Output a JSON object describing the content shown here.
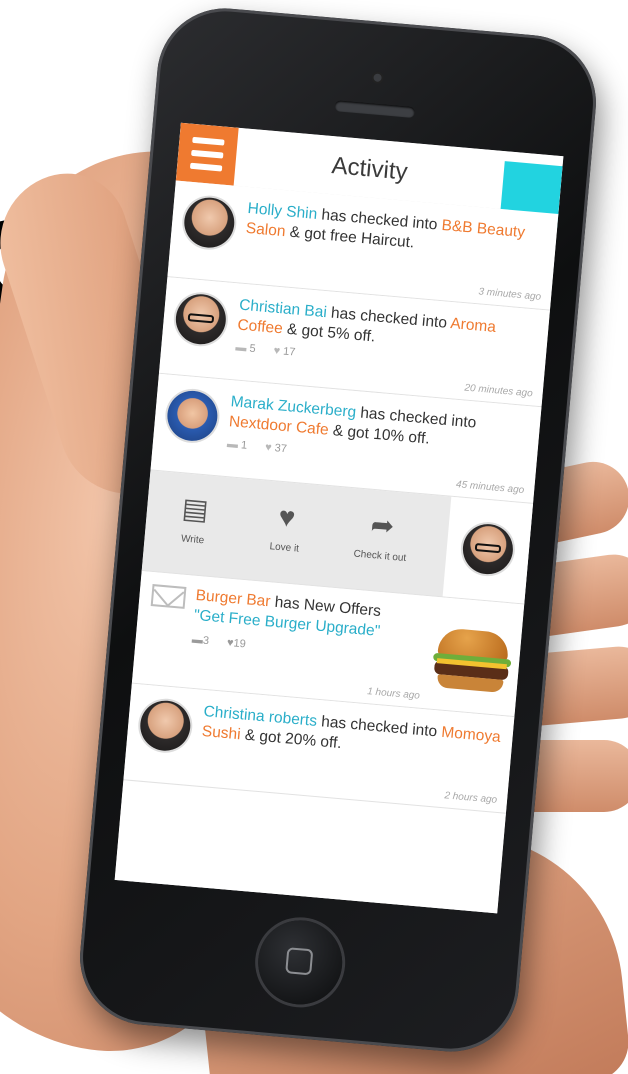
{
  "header": {
    "title": "Activity"
  },
  "feed": [
    {
      "name": "Holly Shin",
      "action": "has checked into",
      "place": "B&B Beauty Salon",
      "reward": "& got free Haircut.",
      "time": "3 minutes ago"
    },
    {
      "name": "Christian Bai",
      "action": "has checked into",
      "place": "Aroma Coffee",
      "reward": "& got 5% off.",
      "comments": "5",
      "likes": "17",
      "time": "20 minutes ago"
    },
    {
      "name": "Marak Zuckerberg",
      "action": "has checked into",
      "place": "Nextdoor Cafe",
      "reward": "& got 10% off.",
      "comments": "1",
      "likes": "37",
      "time": "45 minutes ago"
    }
  ],
  "actions": {
    "write": "Write",
    "love": "Love it",
    "check": "Check it out"
  },
  "offer": {
    "place": "Burger Bar",
    "text": "has New Offers",
    "offer_title": "\"Get Free Burger Upgrade\"",
    "comments": "3",
    "likes": "19",
    "time": "1 hours ago"
  },
  "last_item": {
    "name": "Christina roberts",
    "action": "has checked into",
    "place": "Momoya Sushi",
    "reward": "& got 20% off.",
    "time": "2 hours ago"
  },
  "icons": {
    "menu": "menu-icon",
    "comment": "comment-icon",
    "heart": "heart-icon",
    "share": "share-icon",
    "envelope": "envelope-icon"
  },
  "colors": {
    "accent_orange": "#ef7a30",
    "accent_cyan": "#22d3e0",
    "name_blue": "#2aaec9"
  }
}
